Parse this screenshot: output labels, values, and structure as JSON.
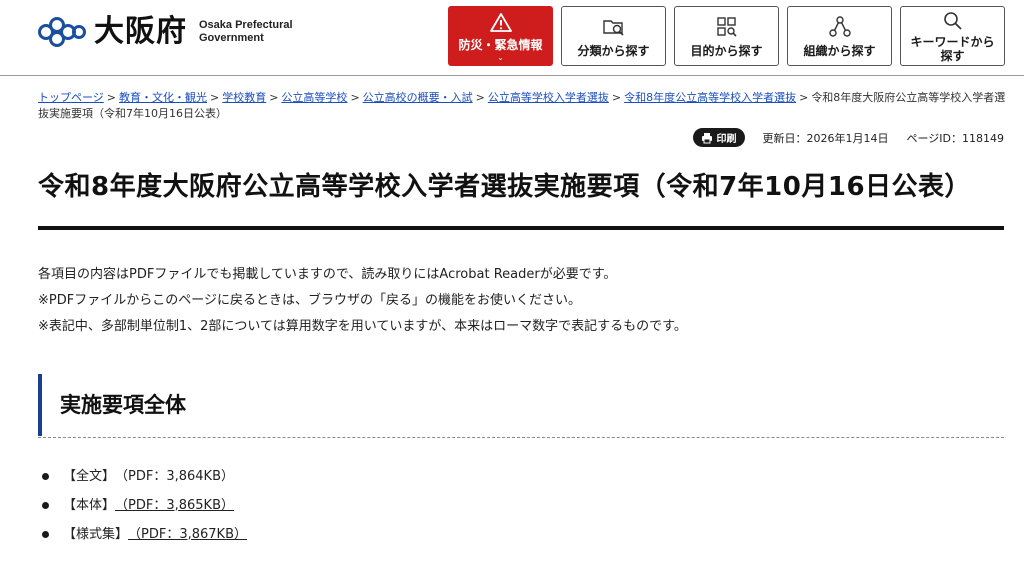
{
  "header": {
    "logo_jp": "大阪府",
    "logo_en_line1": "Osaka Prefectural",
    "logo_en_line2": "Government",
    "nav": [
      {
        "label": "防災・緊急情報",
        "icon": "warning-icon",
        "chevron": "⌄"
      },
      {
        "label": "分類から探す",
        "icon": "folder-search-icon"
      },
      {
        "label": "目的から探す",
        "icon": "grid-search-icon"
      },
      {
        "label": "組織から探す",
        "icon": "org-chart-icon"
      },
      {
        "label": "キーワードから探す",
        "icon": "search-icon"
      }
    ]
  },
  "breadcrumb": {
    "links": [
      "トップページ",
      "教育・文化・観光",
      "学校教育",
      "公立高等学校",
      "公立高校の概要・入試",
      "公立高等学校入学者選抜",
      "令和8年度公立高等学校入学者選抜"
    ],
    "current": "令和8年度大阪府公立高等学校入学者選抜実施要項（令和7年10月16日公表）",
    "separator": ">"
  },
  "meta": {
    "print_label": "印刷",
    "updated": "更新日：2026年1月14日",
    "page_id": "ページID：118149"
  },
  "title": "令和8年度大阪府公立高等学校入学者選抜実施要項（令和7年10月16日公表）",
  "intro": [
    "各項目の内容はPDFファイルでも掲載していますので、読み取りにはAcrobat Readerが必要です。",
    "※PDFファイルからこのページに戻るときは、ブラウザの「戻る」の機能をお使いください。",
    "※表記中、多部制単位制1、2部については算用数字を用いていますが、本来はローマ数字で表記するものです。"
  ],
  "section": {
    "heading": "実施要項全体",
    "files": [
      {
        "label": "【全文】",
        "link": "（PDF：3,864KB）",
        "underlined": false
      },
      {
        "label": "【本体】",
        "link": "（PDF：3,865KB）",
        "underlined": true
      },
      {
        "label": "【様式集】",
        "link": "（PDF：3,867KB）",
        "underlined": true
      }
    ]
  },
  "colors": {
    "emergency": "#cf1c1c",
    "link": "#1a4fbf",
    "section_accent": "#1a3f8f",
    "logo_blue": "#1a4fa0"
  }
}
